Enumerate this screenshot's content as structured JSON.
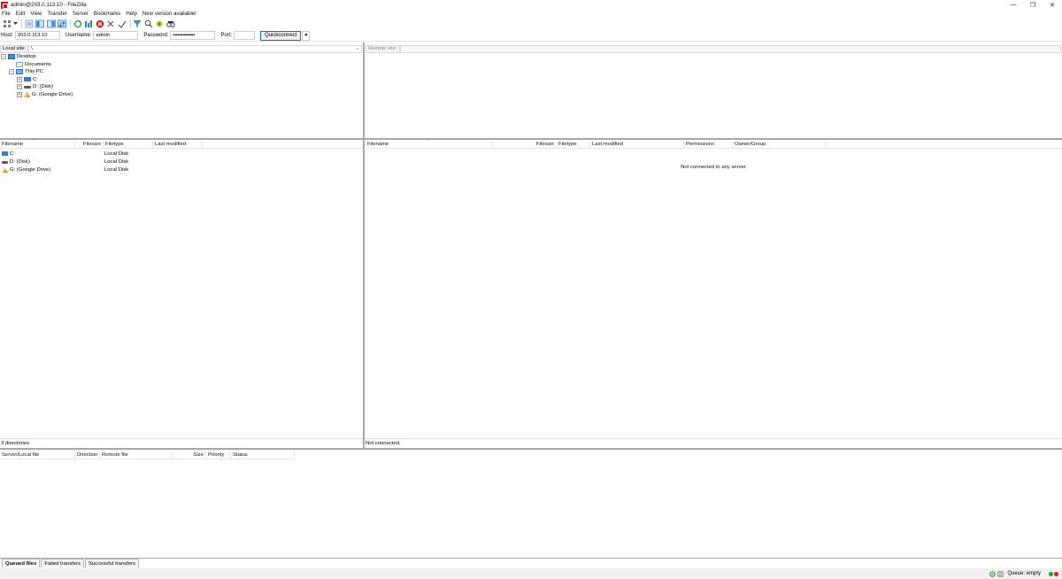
{
  "window": {
    "title": "admin@203.0.113.10 - FileZilla",
    "controls": {
      "minimize": "—",
      "restore": "❐",
      "close": "✕"
    }
  },
  "menu": [
    "File",
    "Edit",
    "View",
    "Transfer",
    "Server",
    "Bookmarks",
    "Help",
    "New version available!"
  ],
  "toolbar": {
    "icons": [
      "site-manager-icon",
      "dropdown-arrow-icon",
      "toggle-message-log-icon",
      "toggle-local-tree-icon",
      "toggle-remote-tree-icon",
      "toggle-transfer-queue-icon",
      "refresh-icon",
      "process-queue-icon",
      "cancel-operation-icon",
      "disconnect-icon",
      "reconnect-icon",
      "directory-filter-icon",
      "sync-browsing-icon",
      "search-remote-icon",
      "compare-directories-icon"
    ]
  },
  "quickconnect": {
    "host_label": "Host:",
    "host_value": "203.0.113.10",
    "username_label": "Username:",
    "username_value": "admin",
    "password_label": "Password:",
    "password_value": "••••••••••••••••",
    "port_label": "Port:",
    "port_value": "",
    "button_label": "Quickconnect",
    "dropdown_glyph": "▼"
  },
  "local": {
    "site_label": "Local site:",
    "site_path": "\\",
    "tree": [
      {
        "label": "Desktop",
        "expander": "−",
        "icon": "desktop-icon",
        "indent": 0
      },
      {
        "label": "Documents",
        "expander": "",
        "icon": "documents-icon",
        "indent": 1
      },
      {
        "label": "This PC",
        "expander": "−",
        "icon": "computer-icon",
        "indent": 1
      },
      {
        "label": "C:",
        "expander": "+",
        "icon": "drive-c-icon",
        "indent": 2
      },
      {
        "label": "D: (Disk)",
        "expander": "+",
        "icon": "drive-icon",
        "indent": 2
      },
      {
        "label": "G: (Google Drive)",
        "expander": "+",
        "icon": "google-drive-icon",
        "indent": 2
      }
    ],
    "columns": [
      "Filename",
      "Filesize",
      "Filetype",
      "Last modified"
    ],
    "files": [
      {
        "name": "C:",
        "size": "",
        "type": "Local Disk",
        "modified": ""
      },
      {
        "name": "D: (Disk)",
        "size": "",
        "type": "Local Disk",
        "modified": ""
      },
      {
        "name": "G: (Google Drive)",
        "size": "",
        "type": "Local Disk",
        "modified": ""
      }
    ],
    "status": "3 directories"
  },
  "remote": {
    "site_label": "Remote site:",
    "site_path": "",
    "columns": [
      "Filename",
      "Filesize",
      "Filetype",
      "Last modified",
      "Permissions",
      "Owner/Group"
    ],
    "empty_message": "Not connected to any server",
    "status": "Not connected."
  },
  "queue": {
    "columns": [
      "Server/Local file",
      "Direction",
      "Remote file",
      "Size",
      "Priority",
      "Status"
    ],
    "tabs": [
      "Queued files",
      "Failed transfers",
      "Successful transfers"
    ],
    "active_tab": "Queued files",
    "status_text": "Queue: empty"
  },
  "colors": {
    "accent": "#0078d7",
    "splitter": "#a8a8a8",
    "led_green": "#1fa31f",
    "led_red": "#d42424"
  }
}
